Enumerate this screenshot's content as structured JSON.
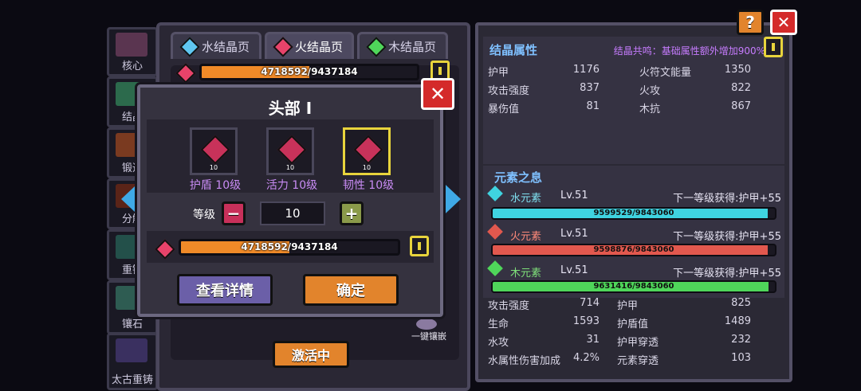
{
  "sidebar": {
    "items": [
      {
        "label": "核心"
      },
      {
        "label": "结晶"
      },
      {
        "label": "锻造"
      },
      {
        "label": "分解"
      },
      {
        "label": "重铸"
      },
      {
        "label": "镶石"
      },
      {
        "label": "太古重铸"
      }
    ]
  },
  "tabs": [
    {
      "label": "水结晶页"
    },
    {
      "label": "火结晶页"
    },
    {
      "label": "木结晶页"
    }
  ],
  "top_bar": {
    "text": "4718592/9437184",
    "progress": 0.5
  },
  "dialog": {
    "title": "头部 I",
    "slots": [
      {
        "label": "护盾 10级",
        "level": "10"
      },
      {
        "label": "活力 10级",
        "level": "10"
      },
      {
        "label": "韧性 10级",
        "level": "10"
      }
    ],
    "level_label": "等级",
    "level_value": "10",
    "minus": "−",
    "plus": "+",
    "bar_text": "4718592/9437184",
    "bar_progress": 0.5,
    "details_button": "查看详情",
    "confirm_button": "确定",
    "close": "✕"
  },
  "activate_button": "激活中",
  "one_click_inlay": "一键镶嵌",
  "stats": {
    "title": "结晶属性",
    "resonance": "结晶共鸣：基础属性额外增加900%",
    "rows": [
      {
        "l1": "护甲",
        "v1": "1176",
        "l2": "火符文能量",
        "v2": "1350"
      },
      {
        "l1": "攻击强度",
        "v1": "837",
        "l2": "火攻",
        "v2": "822"
      },
      {
        "l1": "暴伤值",
        "v1": "81",
        "l2": "木抗",
        "v2": "867"
      }
    ]
  },
  "elements": {
    "title": "元素之息",
    "items": [
      {
        "name": "水元素",
        "level": "Lv.51",
        "next": "下一等级获得:护甲+55",
        "bar": "9599529/9843060",
        "progress": 0.975,
        "color": "#3fd3e0"
      },
      {
        "name": "火元素",
        "level": "Lv.51",
        "next": "下一等级获得:护甲+55",
        "bar": "9598876/9843060",
        "progress": 0.975,
        "color": "#e2584e"
      },
      {
        "name": "木元素",
        "level": "Lv.51",
        "next": "下一等级获得:护甲+55",
        "bar": "9631416/9843060",
        "progress": 0.978,
        "color": "#4fd65a"
      }
    ],
    "rows": [
      {
        "l1": "攻击强度",
        "v1": "714",
        "l2": "护甲",
        "v2": "825"
      },
      {
        "l1": "生命",
        "v1": "1593",
        "l2": "护盾值",
        "v2": "1489"
      },
      {
        "l1": "水攻",
        "v1": "31",
        "l2": "护甲穿透",
        "v2": "232"
      },
      {
        "l1": "水属性伤害加成",
        "v1": "4.2%",
        "l2": "元素穿透",
        "v2": "103"
      }
    ]
  },
  "top_buttons": {
    "help": "?",
    "close": "✕"
  },
  "colors": {
    "accent_orange": "#f08a28",
    "title_blue": "#7fc0ff",
    "resonance_purple": "#c77cff",
    "gold": "#e8d43c"
  }
}
